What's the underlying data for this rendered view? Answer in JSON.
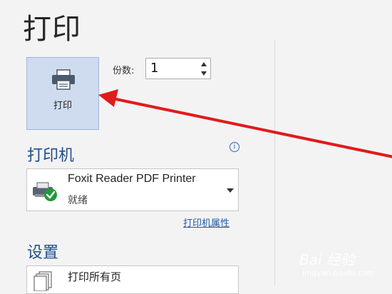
{
  "page": {
    "title": "打印"
  },
  "print_button": {
    "label": "打印",
    "icon": "printer-icon"
  },
  "copies": {
    "label": "份数:",
    "value": "1"
  },
  "printer": {
    "heading": "打印机",
    "name": "Foxit Reader PDF Printer",
    "status": "就绪",
    "properties_link": "打印机属性",
    "icon": "printer-ready-icon"
  },
  "settings": {
    "heading": "设置",
    "pages_option": "打印所有页"
  },
  "annotation": {
    "arrow_color": "#e11b1b"
  },
  "watermark": {
    "text": "Bai 经验",
    "sub": "jingyan.baidu.com"
  }
}
